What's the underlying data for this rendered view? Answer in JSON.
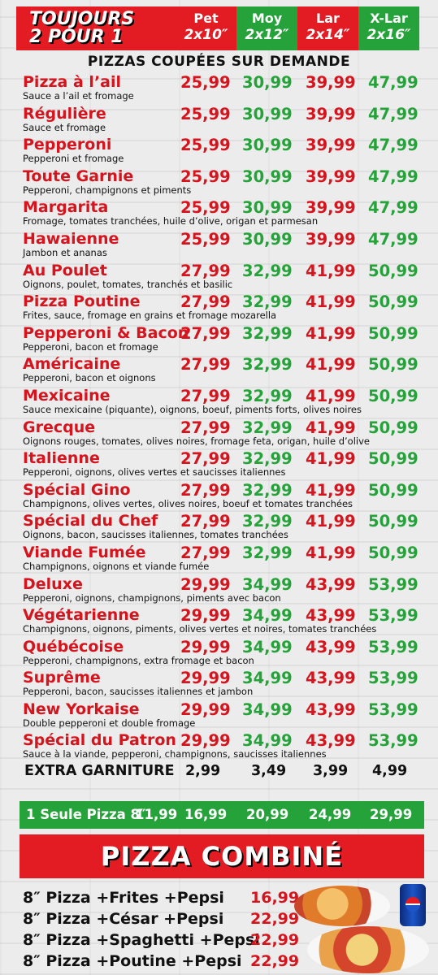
{
  "header": {
    "line1": "TOUJOURS",
    "line2": "2 POUR 1",
    "sizes": [
      {
        "name": "Pet",
        "size": "2x10″"
      },
      {
        "name": "Moy",
        "size": "2x12″"
      },
      {
        "name": "Lar",
        "size": "2x14″"
      },
      {
        "name": "X-Lar",
        "size": "2x16″"
      }
    ]
  },
  "subtitle": "PIZZAS COUPÉES SUR DEMANDE",
  "items": [
    {
      "name": "Pizza à l’ail",
      "desc": "Sauce a l’ail et fromage",
      "prices": [
        "25,99",
        "30,99",
        "39,99",
        "47,99"
      ]
    },
    {
      "name": "Régulière",
      "desc": "Sauce et fromage",
      "prices": [
        "25,99",
        "30,99",
        "39,99",
        "47,99"
      ]
    },
    {
      "name": "Pepperoni",
      "desc": "Pepperoni et fromage",
      "prices": [
        "25,99",
        "30,99",
        "39,99",
        "47,99"
      ]
    },
    {
      "name": "Toute Garnie",
      "desc": "Pepperoni, champignons et piments",
      "prices": [
        "25,99",
        "30,99",
        "39,99",
        "47,99"
      ]
    },
    {
      "name": "Margarita",
      "desc": "Fromage, tomates tranchées, huile d’olive, origan et parmesan",
      "prices": [
        "25,99",
        "30,99",
        "39,99",
        "47,99"
      ]
    },
    {
      "name": "Hawaienne",
      "desc": "Jambon et ananas",
      "prices": [
        "25,99",
        "30,99",
        "39,99",
        "47,99"
      ]
    },
    {
      "name": "Au Poulet",
      "desc": "Oignons, poulet, tomates, tranchés et basilic",
      "prices": [
        "27,99",
        "32,99",
        "41,99",
        "50,99"
      ]
    },
    {
      "name": "Pizza Poutine",
      "desc": "Frites, sauce, fromage en grains et fromage mozarella",
      "prices": [
        "27,99",
        "32,99",
        "41,99",
        "50,99"
      ]
    },
    {
      "name": "Pepperoni & Bacon",
      "desc": "Pepperoni, bacon  et fromage",
      "prices": [
        "27,99",
        "32,99",
        "41,99",
        "50,99"
      ]
    },
    {
      "name": "Américaine",
      "desc": "Pepperoni, bacon et oignons",
      "prices": [
        "27,99",
        "32,99",
        "41,99",
        "50,99"
      ]
    },
    {
      "name": "Mexicaine",
      "desc": "Sauce mexicaine (piquante), oignons, boeuf, piments forts, olives noires",
      "prices": [
        "27,99",
        "32,99",
        "41,99",
        "50,99"
      ]
    },
    {
      "name": "Grecque",
      "desc": "Oignons rouges, tomates, olives noires, fromage feta, origan, huile d’olive",
      "prices": [
        "27,99",
        "32,99",
        "41,99",
        "50,99"
      ]
    },
    {
      "name": "Italienne",
      "desc": "Pepperoni, oignons, olives vertes et saucisses italiennes",
      "prices": [
        "27,99",
        "32,99",
        "41,99",
        "50,99"
      ]
    },
    {
      "name": "Spécial Gino",
      "desc": "Champignons, olives vertes, olives noires, boeuf et tomates tranchées",
      "prices": [
        "27,99",
        "32,99",
        "41,99",
        "50,99"
      ]
    },
    {
      "name": "Spécial du Chef",
      "desc": "Oignons, bacon, saucisses italiennes, tomates tranchées",
      "prices": [
        "27,99",
        "32,99",
        "41,99",
        "50,99"
      ]
    },
    {
      "name": "Viande Fumée",
      "desc": "Champignons, oignons et viande fumée",
      "prices": [
        "27,99",
        "32,99",
        "41,99",
        "50,99"
      ]
    },
    {
      "name": "Deluxe",
      "desc": "Pepperoni, oignons, champignons, piments avec bacon",
      "prices": [
        "29,99",
        "34,99",
        "43,99",
        "53,99"
      ]
    },
    {
      "name": "Végétarienne",
      "desc": "Champignons, oignons, piments, olives vertes et noires, tomates tranchées",
      "prices": [
        "29,99",
        "34,99",
        "43,99",
        "53,99"
      ]
    },
    {
      "name": "Québécoise",
      "desc": "Pepperoni, champignons, extra fromage et bacon",
      "prices": [
        "29,99",
        "34,99",
        "43,99",
        "53,99"
      ]
    },
    {
      "name": "Suprême",
      "desc": "Pepperoni, bacon, saucisses italiennes et jambon",
      "prices": [
        "29,99",
        "34,99",
        "43,99",
        "53,99"
      ]
    },
    {
      "name": "New Yorkaise",
      "desc": "Double pepperoni et double fromage",
      "prices": [
        "29,99",
        "34,99",
        "43,99",
        "53,99"
      ]
    },
    {
      "name": "Spécial du Patron",
      "desc": "Sauce à la viande, pepperoni, champignons, saucisses italiennes",
      "prices": [
        "29,99",
        "34,99",
        "43,99",
        "53,99"
      ]
    }
  ],
  "extra": {
    "label": "EXTRA GARNITURE",
    "prices": [
      "2,99",
      "3,49",
      "3,99",
      "4,99"
    ]
  },
  "single": {
    "label": "1 Seule Pizza 8″",
    "prices": [
      "11,99",
      "16,99",
      "20,99",
      "24,99",
      "29,99"
    ]
  },
  "combine_title": "PIZZA COMBINÉ",
  "combos": [
    {
      "label": "8″ Pizza +Frites +Pepsi",
      "price": "16,99"
    },
    {
      "label": "8″ Pizza +César +Pepsi",
      "price": "22,99"
    },
    {
      "label": "8″ Pizza +Spaghetti +Pepsi",
      "price": "22,99"
    },
    {
      "label": "8″ Pizza +Poutine +Pepsi",
      "price": "22,99"
    }
  ],
  "colors": {
    "red": "#e31b23",
    "green": "#26a23a"
  }
}
